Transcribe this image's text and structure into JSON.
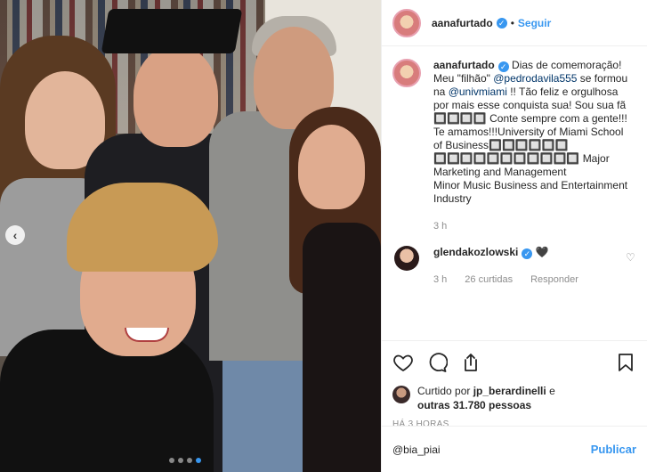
{
  "header": {
    "username": "aanafurtado",
    "separator": "•",
    "follow_label": "Seguir"
  },
  "caption": {
    "username": "aanafurtado",
    "text_1": "Dias de comemoração! Meu \"filhão\" ",
    "mention_1": "@pedrodavila555",
    "text_2": " se formou na ",
    "mention_2": "@univmiami",
    "text_3": " !! Tão feliz e orgulhosa por mais esse conquista sua! Sou sua fã 🔲🔲🔲🔲 Conte sempre com a gente!!! Te amamos!!!University of Miami School of Business🔲🔲🔲🔲🔲🔲 🔲🔲🔲🔲🔲🔲🔲🔲🔲🔲🔲 Major Marketing and Management",
    "text_4": "Minor Music Business and Entertainment Industry",
    "time": "3 h"
  },
  "comment": {
    "username": "glendakozlowski",
    "text": "🖤",
    "time": "3 h",
    "likes": "26 curtidas",
    "reply": "Responder"
  },
  "likes": {
    "prefix": "Curtido por ",
    "user": "jp_berardinelli",
    "middle": " e",
    "others": "outras 31.780 pessoas"
  },
  "timestamp": "HÁ 3 HORAS",
  "add_comment": {
    "value": "@bia_piai",
    "publish_label": "Publicar"
  },
  "colors": {
    "accent": "#3897f0",
    "muted": "#8e8e8e"
  },
  "icons": [
    "heart-icon",
    "comment-icon",
    "share-icon",
    "bookmark-icon",
    "verified-icon",
    "chevron-left-icon"
  ]
}
